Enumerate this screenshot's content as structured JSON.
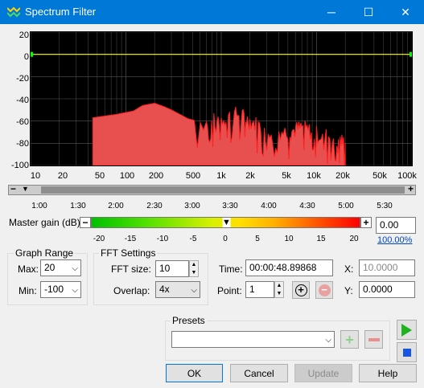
{
  "window": {
    "title": "Spectrum Filter",
    "minimize": "─",
    "maximize": "☐",
    "close": "✕"
  },
  "graph": {
    "y_ticks": [
      "20",
      "0",
      "-20",
      "-40",
      "-60",
      "-80",
      "-100"
    ],
    "x_ticks": [
      "10",
      "20",
      "50",
      "100",
      "200",
      "500",
      "1k",
      "2k",
      "5k",
      "10k",
      "20k",
      "50k",
      "100k"
    ],
    "colors": {
      "fill": "#e85050",
      "line": "#ff2020",
      "zero_line": "#ffff00",
      "bg": "#000000"
    }
  },
  "timeline": {
    "ticks": [
      "1:00",
      "1:30",
      "2:00",
      "2:30",
      "3:00",
      "3:30",
      "4:00",
      "4:30",
      "5:00",
      "5:30"
    ],
    "minus": "−",
    "plus": "+"
  },
  "master_gain": {
    "label": "Master gain (dB):",
    "value": "0.00",
    "percent_link": "100.00%",
    "ticks": [
      "-20",
      "-15",
      "-10",
      "-5",
      "0",
      "5",
      "10",
      "15",
      "20"
    ],
    "level": 0.5,
    "minus": "−",
    "plus": "+"
  },
  "graph_range": {
    "title": "Graph Range",
    "max_label": "Max:",
    "max_value": "20",
    "min_label": "Min:",
    "min_value": "-100"
  },
  "fft_settings": {
    "title": "FFT Settings",
    "size_label": "FFT size:",
    "size_value": "10",
    "overlap_label": "Overlap:",
    "overlap_value": "4x"
  },
  "point_info": {
    "time_label": "Time:",
    "time_value": "00:00:48.89868",
    "x_label": "X:",
    "x_value": "10.0000",
    "point_label": "Point:",
    "point_value": "1",
    "y_label": "Y:",
    "y_value": "0.0000"
  },
  "presets": {
    "title": "Presets",
    "value": ""
  },
  "buttons": {
    "ok": "OK",
    "cancel": "Cancel",
    "update": "Update",
    "help": "Help"
  }
}
